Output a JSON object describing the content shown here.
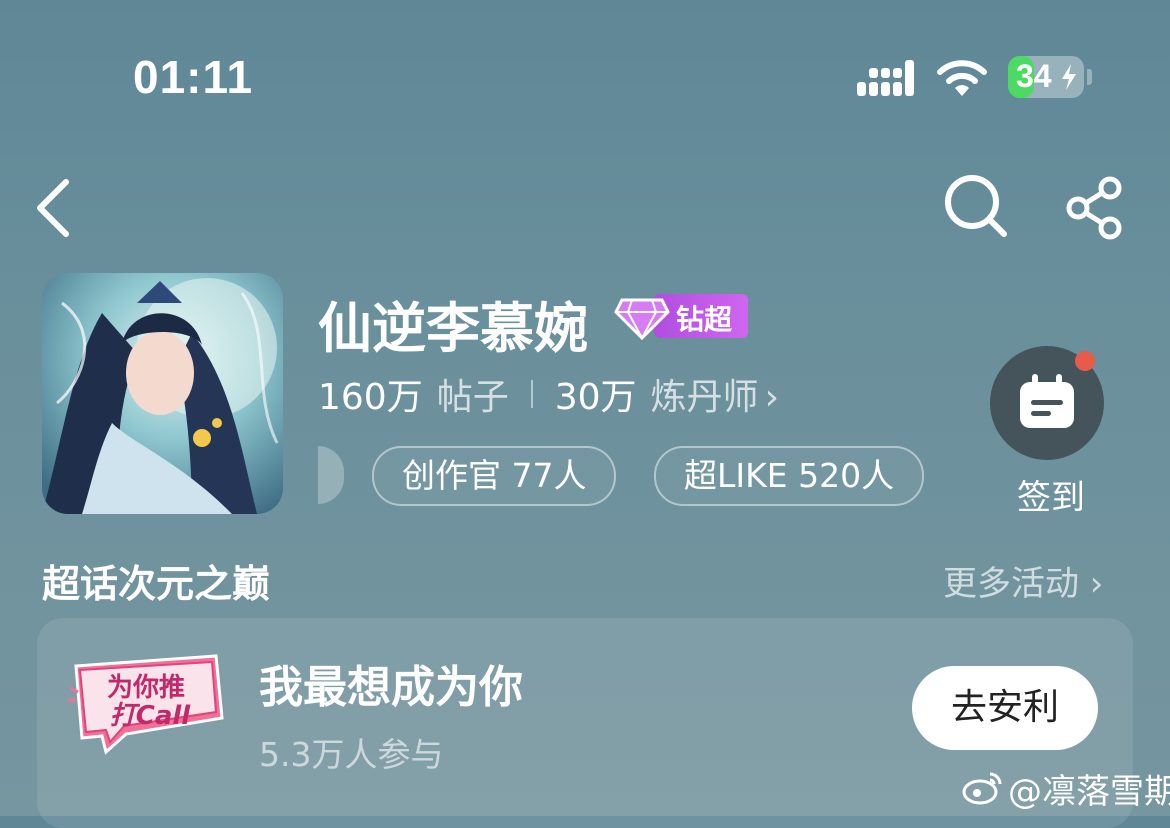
{
  "status_bar": {
    "time": "01:11",
    "battery": "34",
    "battery_level": 0.34
  },
  "header": {
    "back_icon": "chevron-left-icon",
    "search_icon": "search-icon",
    "share_icon": "share-icon"
  },
  "topic": {
    "title": "仙逆李慕婉",
    "badge": "钻超",
    "stats": [
      {
        "num": "160万",
        "label": "帖子"
      },
      {
        "num": "30万",
        "label": "炼丹师"
      }
    ],
    "stats_chevron": "›",
    "pills": [
      "创作官 77人",
      "超LIKE 520人"
    ],
    "checkin_label": "签到"
  },
  "section": {
    "title": "超话次元之巅",
    "more": "更多活动 ›"
  },
  "card": {
    "logo_text_line1": "为你推",
    "logo_text_line2": "打Call",
    "title": "我最想成为你",
    "subtitle": "5.3万人参与",
    "button": "去安利"
  },
  "watermark": "@凛落雪期",
  "colors": {
    "accent_purple": "#c25ce8",
    "notification_red": "#e85a4a",
    "battery_green": "#4cd964"
  }
}
